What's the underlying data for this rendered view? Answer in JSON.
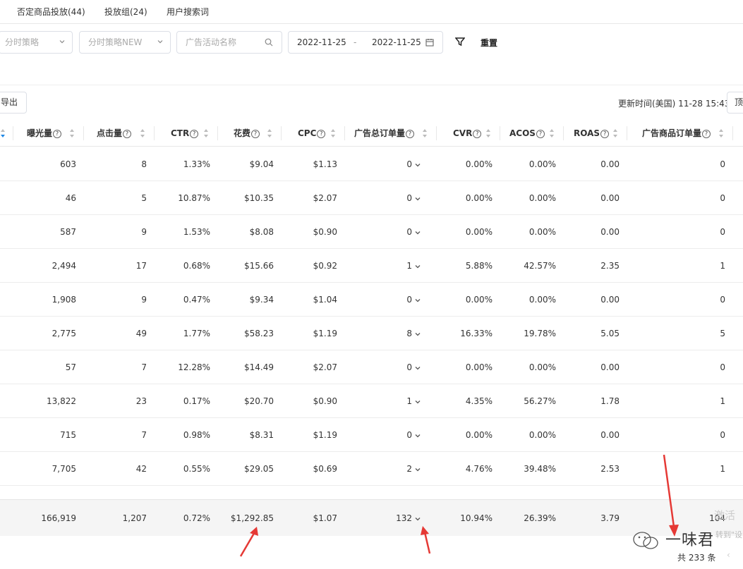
{
  "tabs": [
    {
      "label": "否定商品投放(44)"
    },
    {
      "label": "投放组(24)"
    },
    {
      "label": "用户搜索词"
    }
  ],
  "filters": {
    "strategy_placeholder": "分时策略",
    "strategy_new_placeholder": "分时策略NEW",
    "campaign_placeholder": "广告活动名称",
    "date_start": "2022-11-25",
    "date_sep": "-",
    "date_end": "2022-11-25",
    "reset_label": "重置"
  },
  "toolbar": {
    "export_label": "导出",
    "update_time": "更新时间(美国) 11-28 15:43",
    "top_button_label": "顶"
  },
  "table": {
    "columns": [
      {
        "label": "曝光量",
        "help": "?"
      },
      {
        "label": "点击量",
        "help": "?"
      },
      {
        "label": "CTR",
        "help": "?"
      },
      {
        "label": "花费",
        "help": "?"
      },
      {
        "label": "CPC",
        "help": "?"
      },
      {
        "label": "广告总订单量",
        "help": "?"
      },
      {
        "label": "CVR",
        "help": "?"
      },
      {
        "label": "ACOS",
        "help": "?"
      },
      {
        "label": "ROAS",
        "help": "?"
      },
      {
        "label": "广告商品订单量",
        "help": "?"
      }
    ],
    "rows": [
      [
        "603",
        "8",
        "1.33%",
        "$9.04",
        "$1.13",
        "0",
        "0.00%",
        "0.00%",
        "0.00",
        "0"
      ],
      [
        "46",
        "5",
        "10.87%",
        "$10.35",
        "$2.07",
        "0",
        "0.00%",
        "0.00%",
        "0.00",
        "0"
      ],
      [
        "587",
        "9",
        "1.53%",
        "$8.08",
        "$0.90",
        "0",
        "0.00%",
        "0.00%",
        "0.00",
        "0"
      ],
      [
        "2,494",
        "17",
        "0.68%",
        "$15.66",
        "$0.92",
        "1",
        "5.88%",
        "42.57%",
        "2.35",
        "1"
      ],
      [
        "1,908",
        "9",
        "0.47%",
        "$9.34",
        "$1.04",
        "0",
        "0.00%",
        "0.00%",
        "0.00",
        "0"
      ],
      [
        "2,775",
        "49",
        "1.77%",
        "$58.23",
        "$1.19",
        "8",
        "16.33%",
        "19.78%",
        "5.05",
        "5"
      ],
      [
        "57",
        "7",
        "12.28%",
        "$14.49",
        "$2.07",
        "0",
        "0.00%",
        "0.00%",
        "0.00",
        "0"
      ],
      [
        "13,822",
        "23",
        "0.17%",
        "$20.70",
        "$0.90",
        "1",
        "4.35%",
        "56.27%",
        "1.78",
        "1"
      ],
      [
        "715",
        "7",
        "0.98%",
        "$8.31",
        "$1.19",
        "0",
        "0.00%",
        "0.00%",
        "0.00",
        "0"
      ],
      [
        "7,705",
        "42",
        "0.55%",
        "$29.05",
        "$0.69",
        "2",
        "4.76%",
        "39.48%",
        "2.53",
        "1"
      ]
    ],
    "totals": [
      "166,919",
      "1,207",
      "0.72%",
      "$1,292.85",
      "$1.07",
      "132",
      "10.94%",
      "26.39%",
      "3.79",
      "104"
    ]
  },
  "pagination": {
    "total_label": "共 233 条",
    "prev": "‹"
  },
  "overlay": {
    "watermark_text": "一味君",
    "activate_text": "激活",
    "activate_sub": "转到\"设",
    "annotation_color": "#e53935"
  },
  "colors": {
    "sort_active": "#1e88e5",
    "border": "#dcdfe6"
  }
}
